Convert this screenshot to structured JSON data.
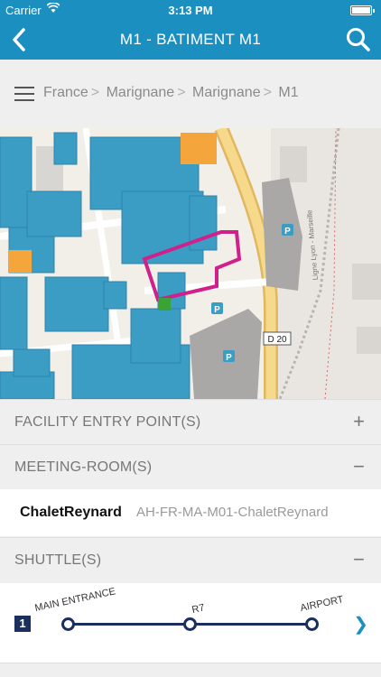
{
  "status_bar": {
    "carrier": "Carrier",
    "time": "3:13 PM"
  },
  "nav": {
    "title": "M1 - BATIMENT M1"
  },
  "breadcrumb": [
    "France",
    "Marignane",
    "Marignane",
    "M1"
  ],
  "map": {
    "road_label": "D 20",
    "rail_label": "Ligne Lyon - Marseille",
    "parking_label": "P"
  },
  "sections": {
    "entry_points": {
      "label": "FACILITY ENTRY POINT(S)",
      "toggle": "+"
    },
    "meeting_rooms": {
      "label": "MEETING-ROOM(S)",
      "toggle": "−"
    },
    "shuttles": {
      "label": "SHUTTLE(S)",
      "toggle": "−"
    }
  },
  "meeting_room": {
    "name": "ChaletReynard",
    "code": "AH-FR-MA-M01-ChaletReynard"
  },
  "shuttle": {
    "number": "1",
    "stops": [
      "MAIN ENTRANCE",
      "R7",
      "AIRPORT"
    ]
  },
  "colors": {
    "accent": "#1a8fc0",
    "line": "#1b2f5e",
    "building": "#3b9cc4",
    "highlight": "#d0208a"
  }
}
